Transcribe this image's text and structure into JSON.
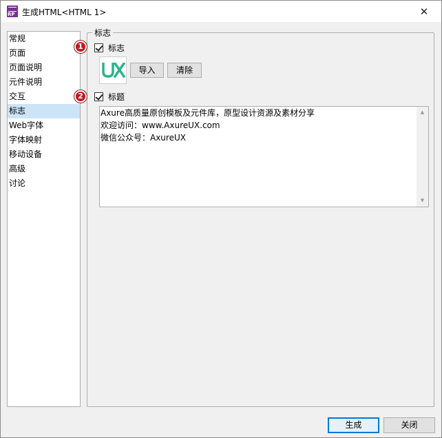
{
  "window": {
    "title": "生成HTML<HTML 1>",
    "app_icon_text": "RP",
    "close_glyph": "✕"
  },
  "sidebar": {
    "items": [
      {
        "label": "常规"
      },
      {
        "label": "页面"
      },
      {
        "label": "页面说明"
      },
      {
        "label": "元件说明"
      },
      {
        "label": "交互"
      },
      {
        "label": "标志",
        "selected": true
      },
      {
        "label": "Web字体"
      },
      {
        "label": "字体映射"
      },
      {
        "label": "移动设备"
      },
      {
        "label": "高级"
      },
      {
        "label": "讨论"
      }
    ]
  },
  "panel": {
    "legend": "标志",
    "logo_section": {
      "badge": "1",
      "checkbox_label": "标志",
      "checked": true,
      "logo_text": "UX",
      "logo_color": "#2bb38a",
      "import_button": "导入",
      "clear_button": "清除"
    },
    "title_section": {
      "badge": "2",
      "checkbox_label": "标题",
      "checked": true,
      "lines": [
        "Axure高质量原创模板及元件库，原型设计资源及素材分享",
        "欢迎访问：www.AxureUX.com",
        "微信公众号：AxureUX"
      ]
    }
  },
  "footer": {
    "generate_button": "生成",
    "close_button": "关闭"
  },
  "colors": {
    "selected_bg": "#cce4f7",
    "badge_red": "#c0191f",
    "primary_border": "#0078d7"
  }
}
